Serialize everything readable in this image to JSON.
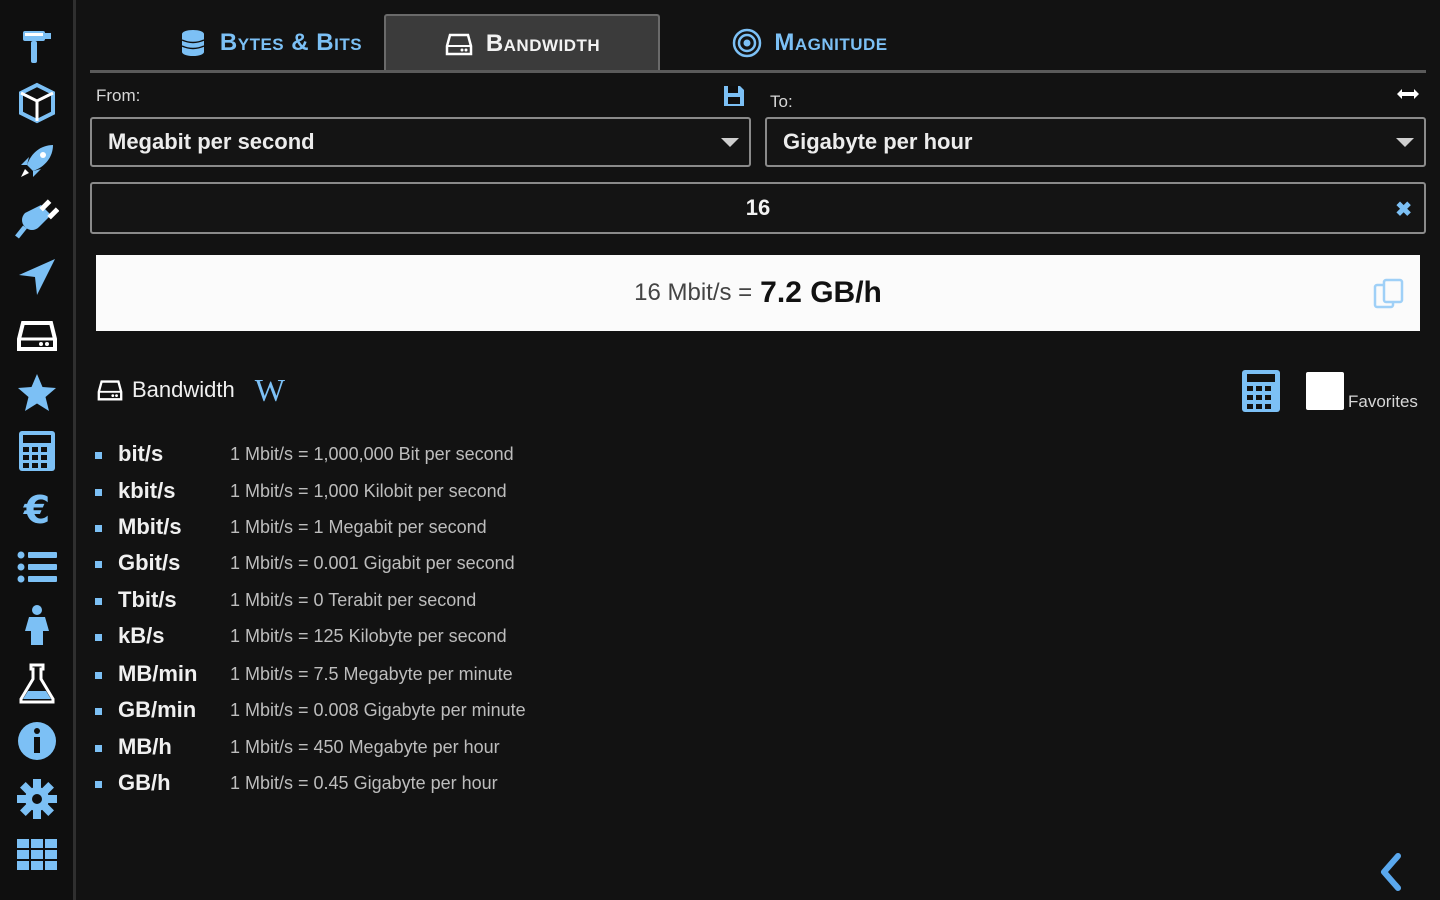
{
  "sidebar": {
    "icons": [
      "hammer-icon",
      "cube-icon",
      "rocket-icon",
      "plug-icon",
      "location-arrow-icon",
      "hard-drive-icon",
      "star-icon",
      "calculator-icon",
      "euro-icon",
      "list-icon",
      "person-icon",
      "flask-icon",
      "info-icon",
      "gear-icon",
      "grid-icon"
    ]
  },
  "tabs": [
    {
      "label": "Bytes & Bits",
      "icon": "database-icon",
      "active": false
    },
    {
      "label": "Bandwidth",
      "icon": "hard-drive-icon",
      "active": true
    },
    {
      "label": "Magnitude",
      "icon": "target-icon",
      "active": false
    }
  ],
  "converter": {
    "from_label": "From:",
    "to_label": "To:",
    "from_value": "Megabit per second",
    "to_value": "Gigabyte per hour",
    "input_value": "16",
    "clear_symbol": "✖"
  },
  "result": {
    "lhs": "16 Mbit/s =",
    "rhs": "7.2 GB/h"
  },
  "section": {
    "title": "Bandwidth",
    "wiki_symbol": "W",
    "favorites_label": "Favorites"
  },
  "units": [
    {
      "name": "bit/s",
      "eq": "1 Mbit/s = 1,000,000 Bit per second"
    },
    {
      "name": "kbit/s",
      "eq": "1 Mbit/s = 1,000 Kilobit per second"
    },
    {
      "name": "Mbit/s",
      "eq": "1 Mbit/s = 1 Megabit per second"
    },
    {
      "name": "Gbit/s",
      "eq": "1 Mbit/s = 0.001 Gigabit per second"
    },
    {
      "name": "Tbit/s",
      "eq": "1 Mbit/s = 0 Terabit per second"
    },
    {
      "name": "kB/s",
      "eq": "1 Mbit/s = 125 Kilobyte per second"
    },
    {
      "name": "MB/min",
      "eq": "1 Mbit/s = 7.5 Megabyte per minute"
    },
    {
      "name": "GB/min",
      "eq": "1 Mbit/s = 0.008 Gigabyte per minute"
    },
    {
      "name": "MB/h",
      "eq": "1 Mbit/s = 450 Megabyte per hour"
    },
    {
      "name": "GB/h",
      "eq": "1 Mbit/s = 0.45 Gigabyte per hour"
    }
  ],
  "colors": {
    "accent": "#7cc0f5",
    "background": "#121212",
    "result_bg": "#fbfbfb"
  }
}
